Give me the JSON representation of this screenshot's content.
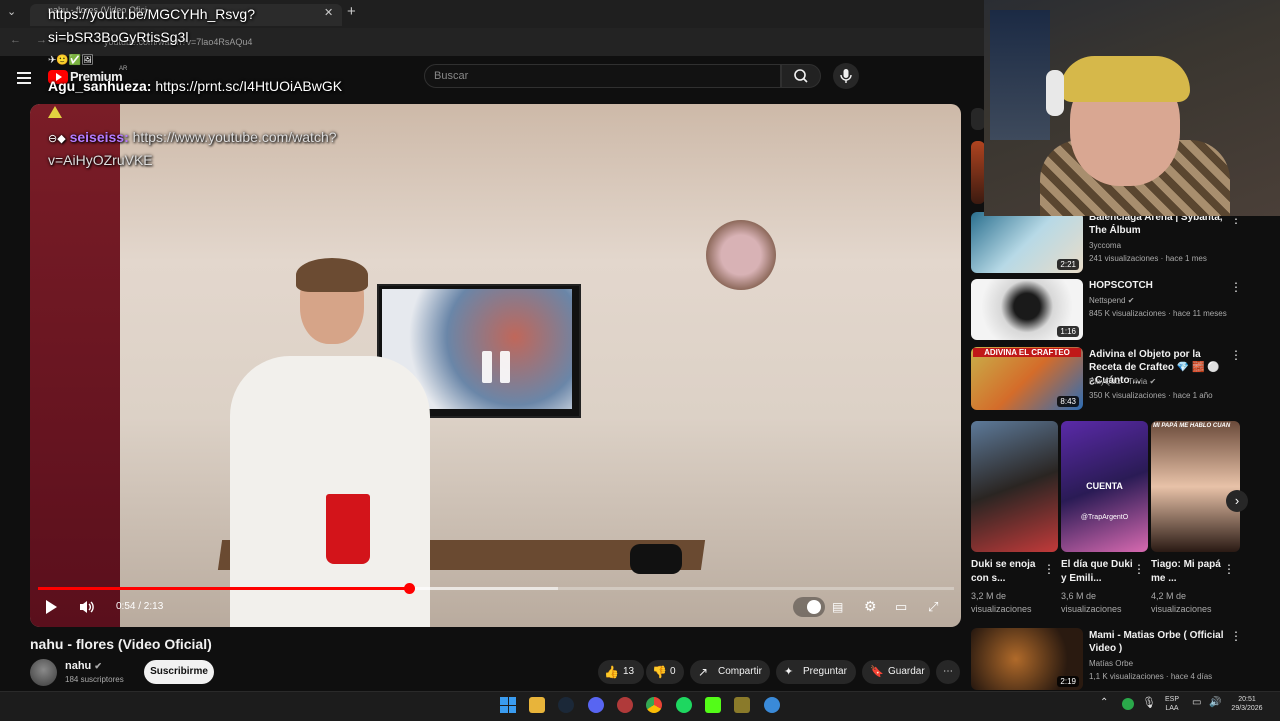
{
  "browser": {
    "tab_title": "nahu - flores (Video Ofici",
    "url": "youtube.com/watch?v=7lao4RsAQu4"
  },
  "youtube": {
    "logo_text": "Premium",
    "logo_region": "AR",
    "search_placeholder": "Buscar"
  },
  "chat_overlay": [
    {
      "user": "",
      "text": "https://youtu.be/MGCYHh_Rsvg?"
    },
    {
      "user": "",
      "text": "si=bSR3BoGyRtisSg3l"
    },
    {
      "user": "Agu_sanhueza:",
      "text": "https://prnt.sc/I4HtUOiABwGK",
      "color": "#ffffff"
    },
    {
      "user": "seiseiss:",
      "text": "https://www.youtube.com/watch?",
      "color": "#b57bff"
    },
    {
      "user": "",
      "text": "v=AiHyOZruVKE"
    }
  ],
  "video": {
    "time": "0:54 / 2:13",
    "progress_fraction": 0.405,
    "buffered_fraction": 0.568,
    "title": "nahu - flores (Video Oficial)"
  },
  "channel": {
    "name": "nahu",
    "subscribers": "184 suscriptores",
    "subscribe_label": "Suscribirme"
  },
  "actions": {
    "likes": "13",
    "dislikes": "0",
    "share": "Compartir",
    "ask": "Preguntar",
    "save": "Guardar"
  },
  "sidebar": {
    "videos": [
      {
        "title": "Balenciaga Arena | Sybanta, The Álbum",
        "channel": "3yccoma",
        "meta": "241 visualizaciones · hace 1 mes",
        "duration": "2:21"
      },
      {
        "title": "HOPSCOTCH",
        "channel": "Nettspend",
        "meta": "845 K visualizaciones · hace 11 meses",
        "duration": "1:16"
      },
      {
        "title": "Adivina el Objeto por la Receta de Crafteo 💎 🧱 ⚪ ¿Cuánto ...",
        "channel": "PlayQuiz - Trivia",
        "meta": "350 K visualizaciones · hace 1 año",
        "duration": "8:43",
        "thumb_text": "ADIVINA EL CRAFTEO"
      },
      {
        "title": "Mami - Matias Orbe ( Official Video )",
        "channel": "Matías Orbe",
        "meta": "1,1 K visualizaciones · hace 4 días",
        "duration": "2:19"
      }
    ],
    "shorts": [
      {
        "title": "Duki se enoja con s...",
        "views": "3,2 M de visualizaciones"
      },
      {
        "title": "El día que Duki y Emili...",
        "views": "3,6 M de visualizaciones",
        "thumb_text": "CUENTA",
        "thumb_tag": "@TrapArgentO"
      },
      {
        "title": "Tiago: Mi papá me ...",
        "views": "4,2 M de visualizaciones",
        "thumb_text": "MI PAPÁ ME HABLO CUAN"
      }
    ]
  },
  "taskbar": {
    "lang": "ESP",
    "lang2": "LAA",
    "time": "20:51",
    "date": "29/3/2026"
  }
}
